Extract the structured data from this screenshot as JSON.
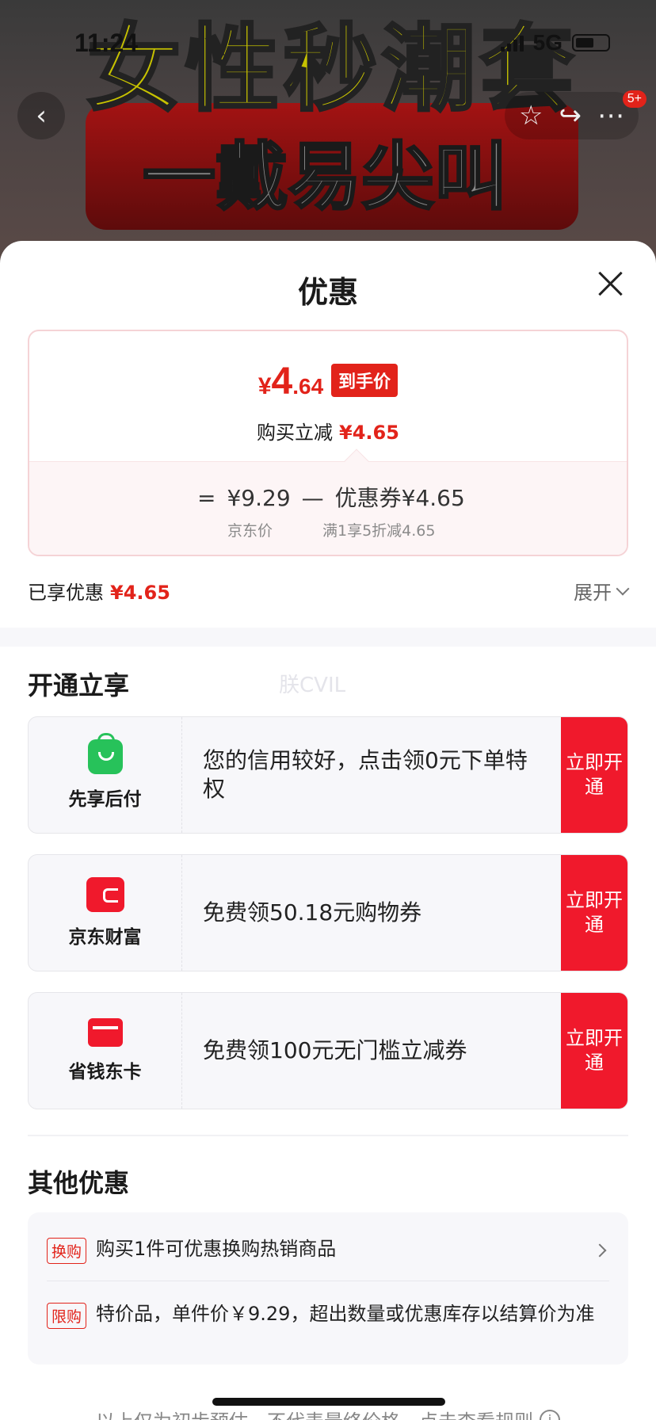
{
  "status_bar": {
    "time": "11:24",
    "network": "5G"
  },
  "banner": {
    "headline": "女性秒潮套",
    "subline": "一戴易尖叫",
    "badge": "5+"
  },
  "nav": {
    "back_icon": "chevron-left-icon",
    "icons": [
      "star-icon",
      "share-icon",
      "more-icon"
    ]
  },
  "sheet": {
    "title": "优惠",
    "price_card": {
      "final_yen": "¥",
      "final_int": "4",
      "final_dec": ".64",
      "final_tag": "到手价",
      "reduce_label": "购买立减",
      "reduce_amount": "¥4.65",
      "eq": "=",
      "jd_price": "¥9.29",
      "minus": "—",
      "coupon_label": "优惠券¥4.65",
      "jd_price_label": "京东价",
      "coupon_rule": "满1享5折减4.65"
    },
    "enjoyed_label": "已享优惠",
    "enjoyed_amount": "¥4.65",
    "expand_label": "展开"
  },
  "open_section": {
    "title": "开通立享",
    "watermark": "朕CVIL",
    "offers": [
      {
        "name": "先享后付",
        "icon": "shopping-bag-icon",
        "desc": "您的信用较好，点击领0元下单特权",
        "cta": "立即开通"
      },
      {
        "name": "京东财富",
        "icon": "wallet-icon",
        "desc": "免费领50.18元购物券",
        "cta": "立即开通"
      },
      {
        "name": "省钱东卡",
        "icon": "card-icon",
        "desc": "免费领100元无门槛立减券",
        "cta": "立即开通"
      }
    ]
  },
  "other_section": {
    "title": "其他优惠",
    "items": [
      {
        "tag": "换购",
        "text": "购买1件可优惠换购热销商品"
      },
      {
        "tag": "限购",
        "text": "特价品，单件价￥9.29，超出数量或优惠库存以结算价为准"
      }
    ]
  },
  "footer": {
    "note": "以上仅为初步预估，不代表最终价格，点击查看规则",
    "info_icon": "i"
  },
  "colors": {
    "accent_red": "#e2231a",
    "cta_red": "#f0192c",
    "green": "#27c25a"
  }
}
